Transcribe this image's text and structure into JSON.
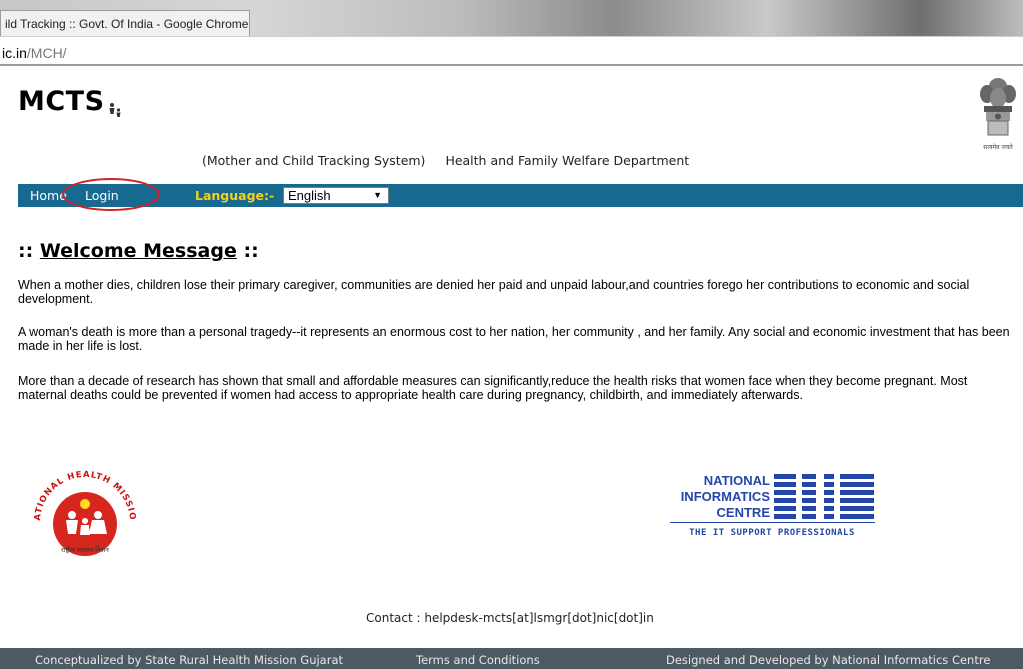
{
  "browser": {
    "tab_title": "ild Tracking :: Govt. Of India - Google Chrome",
    "url_domain": "ic.in",
    "url_path": "/MCH/"
  },
  "header": {
    "logo_text": "MCTS",
    "system_name": "(Mother and Child Tracking System)",
    "department": "Health and Family Welfare Department"
  },
  "nav": {
    "home": "Home",
    "login": "Login",
    "language_label": "Language:-",
    "language_selected": "English"
  },
  "main": {
    "welcome_prefix": "::",
    "welcome_title": "Welcome Message",
    "welcome_suffix": "::",
    "paragraphs": [
      "When a mother dies, children lose their primary caregiver, communities are denied her paid and unpaid labour,and countries forego her contributions to economic and social development.",
      "A woman's death is more than a personal tragedy--it represents an enormous cost to her nation, her community , and her family. Any social and economic investment that has been made in her life is lost.",
      "More than a decade of research has shown that small and affordable measures can significantly,reduce the health risks that women face when they become pregnant. Most maternal deaths could be prevented if women had access to appropriate health care during pregnancy, childbirth, and immediately afterwards."
    ]
  },
  "logos": {
    "nhm_text": "NATIONAL HEALTH MISSION",
    "nhm_tagline": "राष्ट्रीय स्वास्थ्य मिशन",
    "nic_line1": "NATIONAL",
    "nic_line2": "INFORMATICS",
    "nic_line3": "CENTRE",
    "nic_tagline": "THE IT SUPPORT PROFESSIONALS",
    "emblem_caption": "सत्यमेव जयते"
  },
  "contact": "Contact : helpdesk-mcts[at]lsmgr[dot]nic[dot]in",
  "footer": {
    "left": "Conceptualized by State Rural Health Mission Gujarat",
    "center": "Terms and Conditions",
    "right": "Designed and Developed by National Informatics Centre"
  },
  "colors": {
    "nav_bg": "#18698f",
    "language_label": "#f3d21a",
    "footer_bg": "#4d5a63",
    "annotation_circle": "#d62020"
  }
}
